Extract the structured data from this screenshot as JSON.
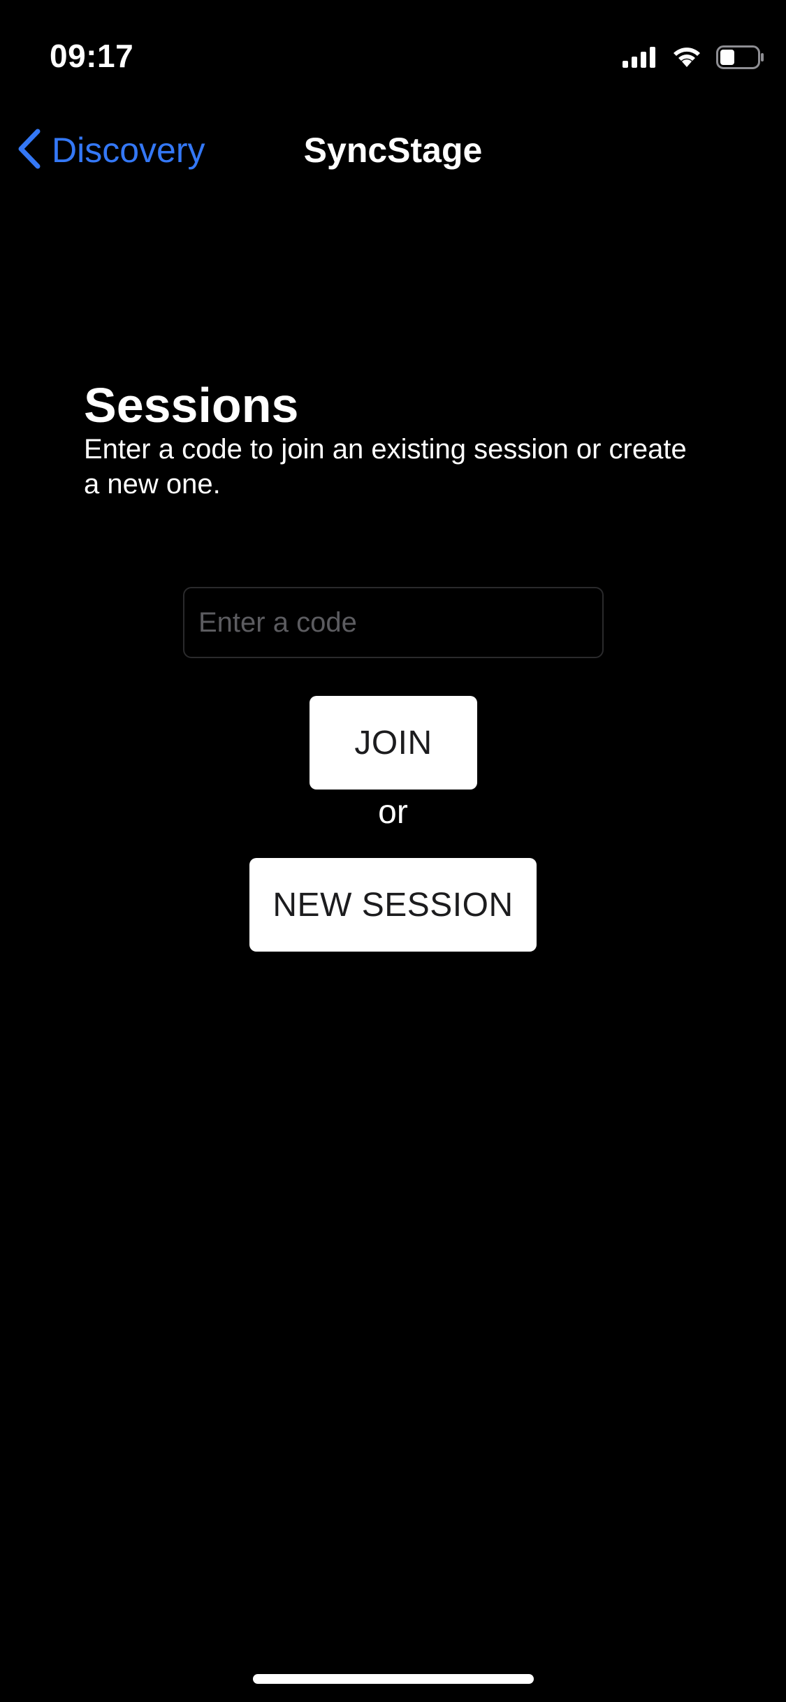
{
  "status_bar": {
    "time": "09:17",
    "icons": [
      "cellular-signal-icon",
      "wifi-icon",
      "battery-icon"
    ],
    "battery_level": 0.4
  },
  "nav": {
    "back_label": "Discovery",
    "title": "SyncStage",
    "accent_color": "#3478f6"
  },
  "sessions": {
    "title": "Sessions",
    "subtitle": "Enter a code to join an existing session or create a new one.",
    "code_input": {
      "placeholder": "Enter a code",
      "value": ""
    },
    "join_label": "JOIN",
    "or_label": "or",
    "new_session_label": "NEW SESSION"
  }
}
